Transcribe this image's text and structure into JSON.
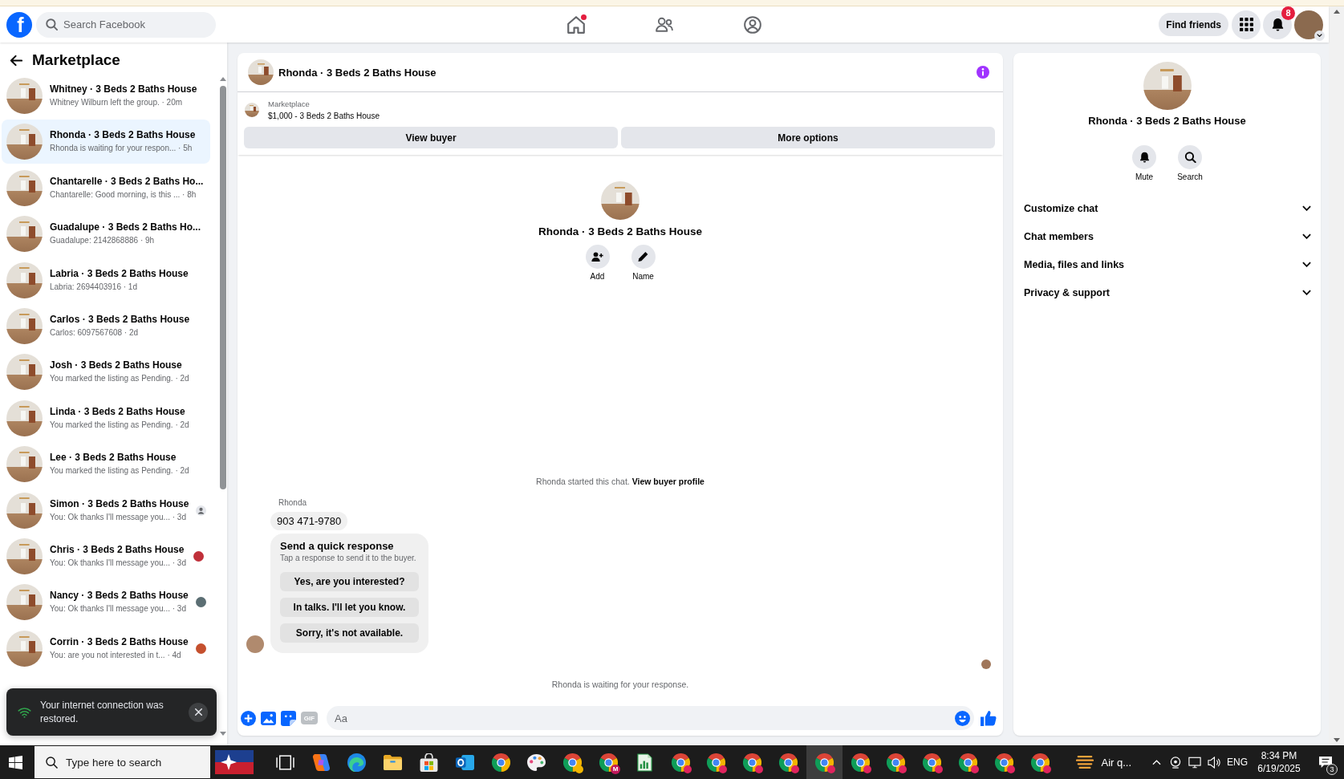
{
  "header": {
    "logo": "f",
    "search": {
      "placeholder": "Search Facebook"
    },
    "nav": [
      {
        "kind": "home",
        "selected": false,
        "unread": true
      },
      {
        "kind": "friends",
        "selected": false,
        "unread": false
      },
      {
        "kind": "profile",
        "selected": false,
        "unread": false
      }
    ],
    "find_friends": "Find friends",
    "notification_count": "8"
  },
  "sidebar": {
    "title": "Marketplace",
    "conversations": [
      {
        "title": "Whitney · 3 Beds 2 Baths House",
        "preview": "Whitney Wilburn left the group. · 20m",
        "selected": false
      },
      {
        "title": "Rhonda · 3 Beds 2 Baths House",
        "preview": "Rhonda is waiting for your respon... · 5h",
        "selected": true
      },
      {
        "title": "Chantarelle · 3 Beds 2 Baths Ho...",
        "preview": "Chantarelle: Good morning, is this ... · 8h",
        "selected": false
      },
      {
        "title": "Guadalupe · 3 Beds 2 Baths Ho...",
        "preview": "Guadalupe: 2142868886 · 9h",
        "selected": false
      },
      {
        "title": "Labria · 3 Beds 2 Baths House",
        "preview": "Labria: 2694403916 · 1d",
        "selected": false
      },
      {
        "title": "Carlos · 3 Beds 2 Baths House",
        "preview": "Carlos: 6097567608 · 2d",
        "selected": false
      },
      {
        "title": "Josh · 3 Beds 2 Baths House",
        "preview": "You marked the listing as Pending. · 2d",
        "selected": false
      },
      {
        "title": "Linda · 3 Beds 2 Baths House",
        "preview": "You marked the listing as Pending. · 2d",
        "selected": false
      },
      {
        "title": "Lee · 3 Beds 2 Baths House",
        "preview": "You marked the listing as Pending. · 2d",
        "selected": false
      },
      {
        "title": "Simon · 3 Beds 2 Baths House",
        "preview": "You: Ok thanks I'll message you... · 3d",
        "selected": false,
        "receipt": {
          "kind": "silhouette"
        }
      },
      {
        "title": "Chris · 3 Beds 2 Baths House",
        "preview": "You: Ok thanks I'll message you... · 3d",
        "selected": false,
        "receipt": {
          "kind": "photo",
          "color": "#c0303a"
        }
      },
      {
        "title": "Nancy · 3 Beds 2 Baths House",
        "preview": "You: Ok thanks I'll message you... · 3d",
        "selected": false,
        "receipt": {
          "kind": "photo",
          "color": "#5b6e73"
        }
      },
      {
        "title": "Corrin · 3 Beds 2 Baths House",
        "preview": "You: are you not interested in t... · 4d",
        "selected": false,
        "receipt": {
          "kind": "photo",
          "color": "#c5502e"
        }
      }
    ]
  },
  "toast": {
    "message": "Your internet connection was restored."
  },
  "chat": {
    "title": "Rhonda · 3 Beds 2 Baths House",
    "listing": {
      "source": "Marketplace",
      "title": "$1,000 - 3 Beds 2 Baths House"
    },
    "buttons": [
      "View buyer",
      "More options"
    ],
    "intro": {
      "title": "Rhonda · 3 Beds 2 Baths House",
      "actions": [
        {
          "kind": "add",
          "label": "Add"
        },
        {
          "kind": "name",
          "label": "Name"
        }
      ]
    },
    "note": {
      "text": "Rhonda started this chat.",
      "link": "View buyer profile"
    },
    "sender": "Rhonda",
    "message": "903 471-9780",
    "quick": {
      "title": "Send a quick response",
      "subtitle": "Tap a response to send it to the buyer.",
      "options": [
        "Yes, are you interested?",
        "In talks. I'll let you know.",
        "Sorry, it's not available."
      ]
    },
    "status": "Rhonda is waiting for your response.",
    "composer": {
      "placeholder": "Aa",
      "tools": [
        {
          "kind": "plus"
        },
        {
          "kind": "photo"
        },
        {
          "kind": "sticker"
        },
        {
          "kind": "gif",
          "label": "GIF"
        }
      ]
    }
  },
  "details": {
    "title": "Rhonda · 3 Beds 2 Baths House",
    "actions": [
      {
        "kind": "mute",
        "label": "Mute"
      },
      {
        "kind": "search",
        "label": "Search"
      }
    ],
    "sections": [
      {
        "label": "Customize chat",
        "expanded": false
      },
      {
        "label": "Chat members",
        "expanded": false
      },
      {
        "label": "Media, files and links",
        "expanded": false
      },
      {
        "label": "Privacy & support",
        "expanded": false
      }
    ]
  },
  "taskbar": {
    "search_placeholder": "Type here to search",
    "apps": [
      {
        "kind": "taskview",
        "selected": false
      },
      {
        "kind": "copilot",
        "selected": false
      },
      {
        "kind": "edge",
        "selected": false
      },
      {
        "kind": "explorer",
        "selected": false
      },
      {
        "kind": "store",
        "selected": false
      },
      {
        "kind": "outlook",
        "selected": false
      },
      {
        "kind": "chrome",
        "selected": false
      },
      {
        "kind": "paint",
        "selected": false
      },
      {
        "kind": "chrome",
        "selected": false,
        "color": "#f2b600"
      },
      {
        "kind": "chrome",
        "selected": false,
        "color": "#c2185b",
        "badge": "M"
      },
      {
        "kind": "sheet",
        "selected": false
      },
      {
        "kind": "chrome",
        "selected": false,
        "color": "#e0245e"
      },
      {
        "kind": "chrome",
        "selected": false,
        "color": "#e0245e"
      },
      {
        "kind": "chrome",
        "selected": false,
        "color": "#e0245e"
      },
      {
        "kind": "chrome",
        "selected": false,
        "color": "#e0245e"
      },
      {
        "kind": "chrome",
        "selected": true,
        "color": "#e0245e"
      },
      {
        "kind": "chrome",
        "selected": false,
        "color": "#e0245e"
      },
      {
        "kind": "chrome",
        "selected": false,
        "color": "#e0245e"
      },
      {
        "kind": "chrome",
        "selected": false,
        "color": "#e0245e"
      },
      {
        "kind": "chrome",
        "selected": false,
        "color": "#e0245e"
      },
      {
        "kind": "chrome",
        "selected": false,
        "color": "#e0245e"
      },
      {
        "kind": "chrome",
        "selected": false,
        "color": "#e0245e"
      }
    ],
    "weather": "Air q...",
    "language": "ENG",
    "time": "8:34 PM",
    "date": "6/19/2025",
    "notification_count": "3"
  }
}
